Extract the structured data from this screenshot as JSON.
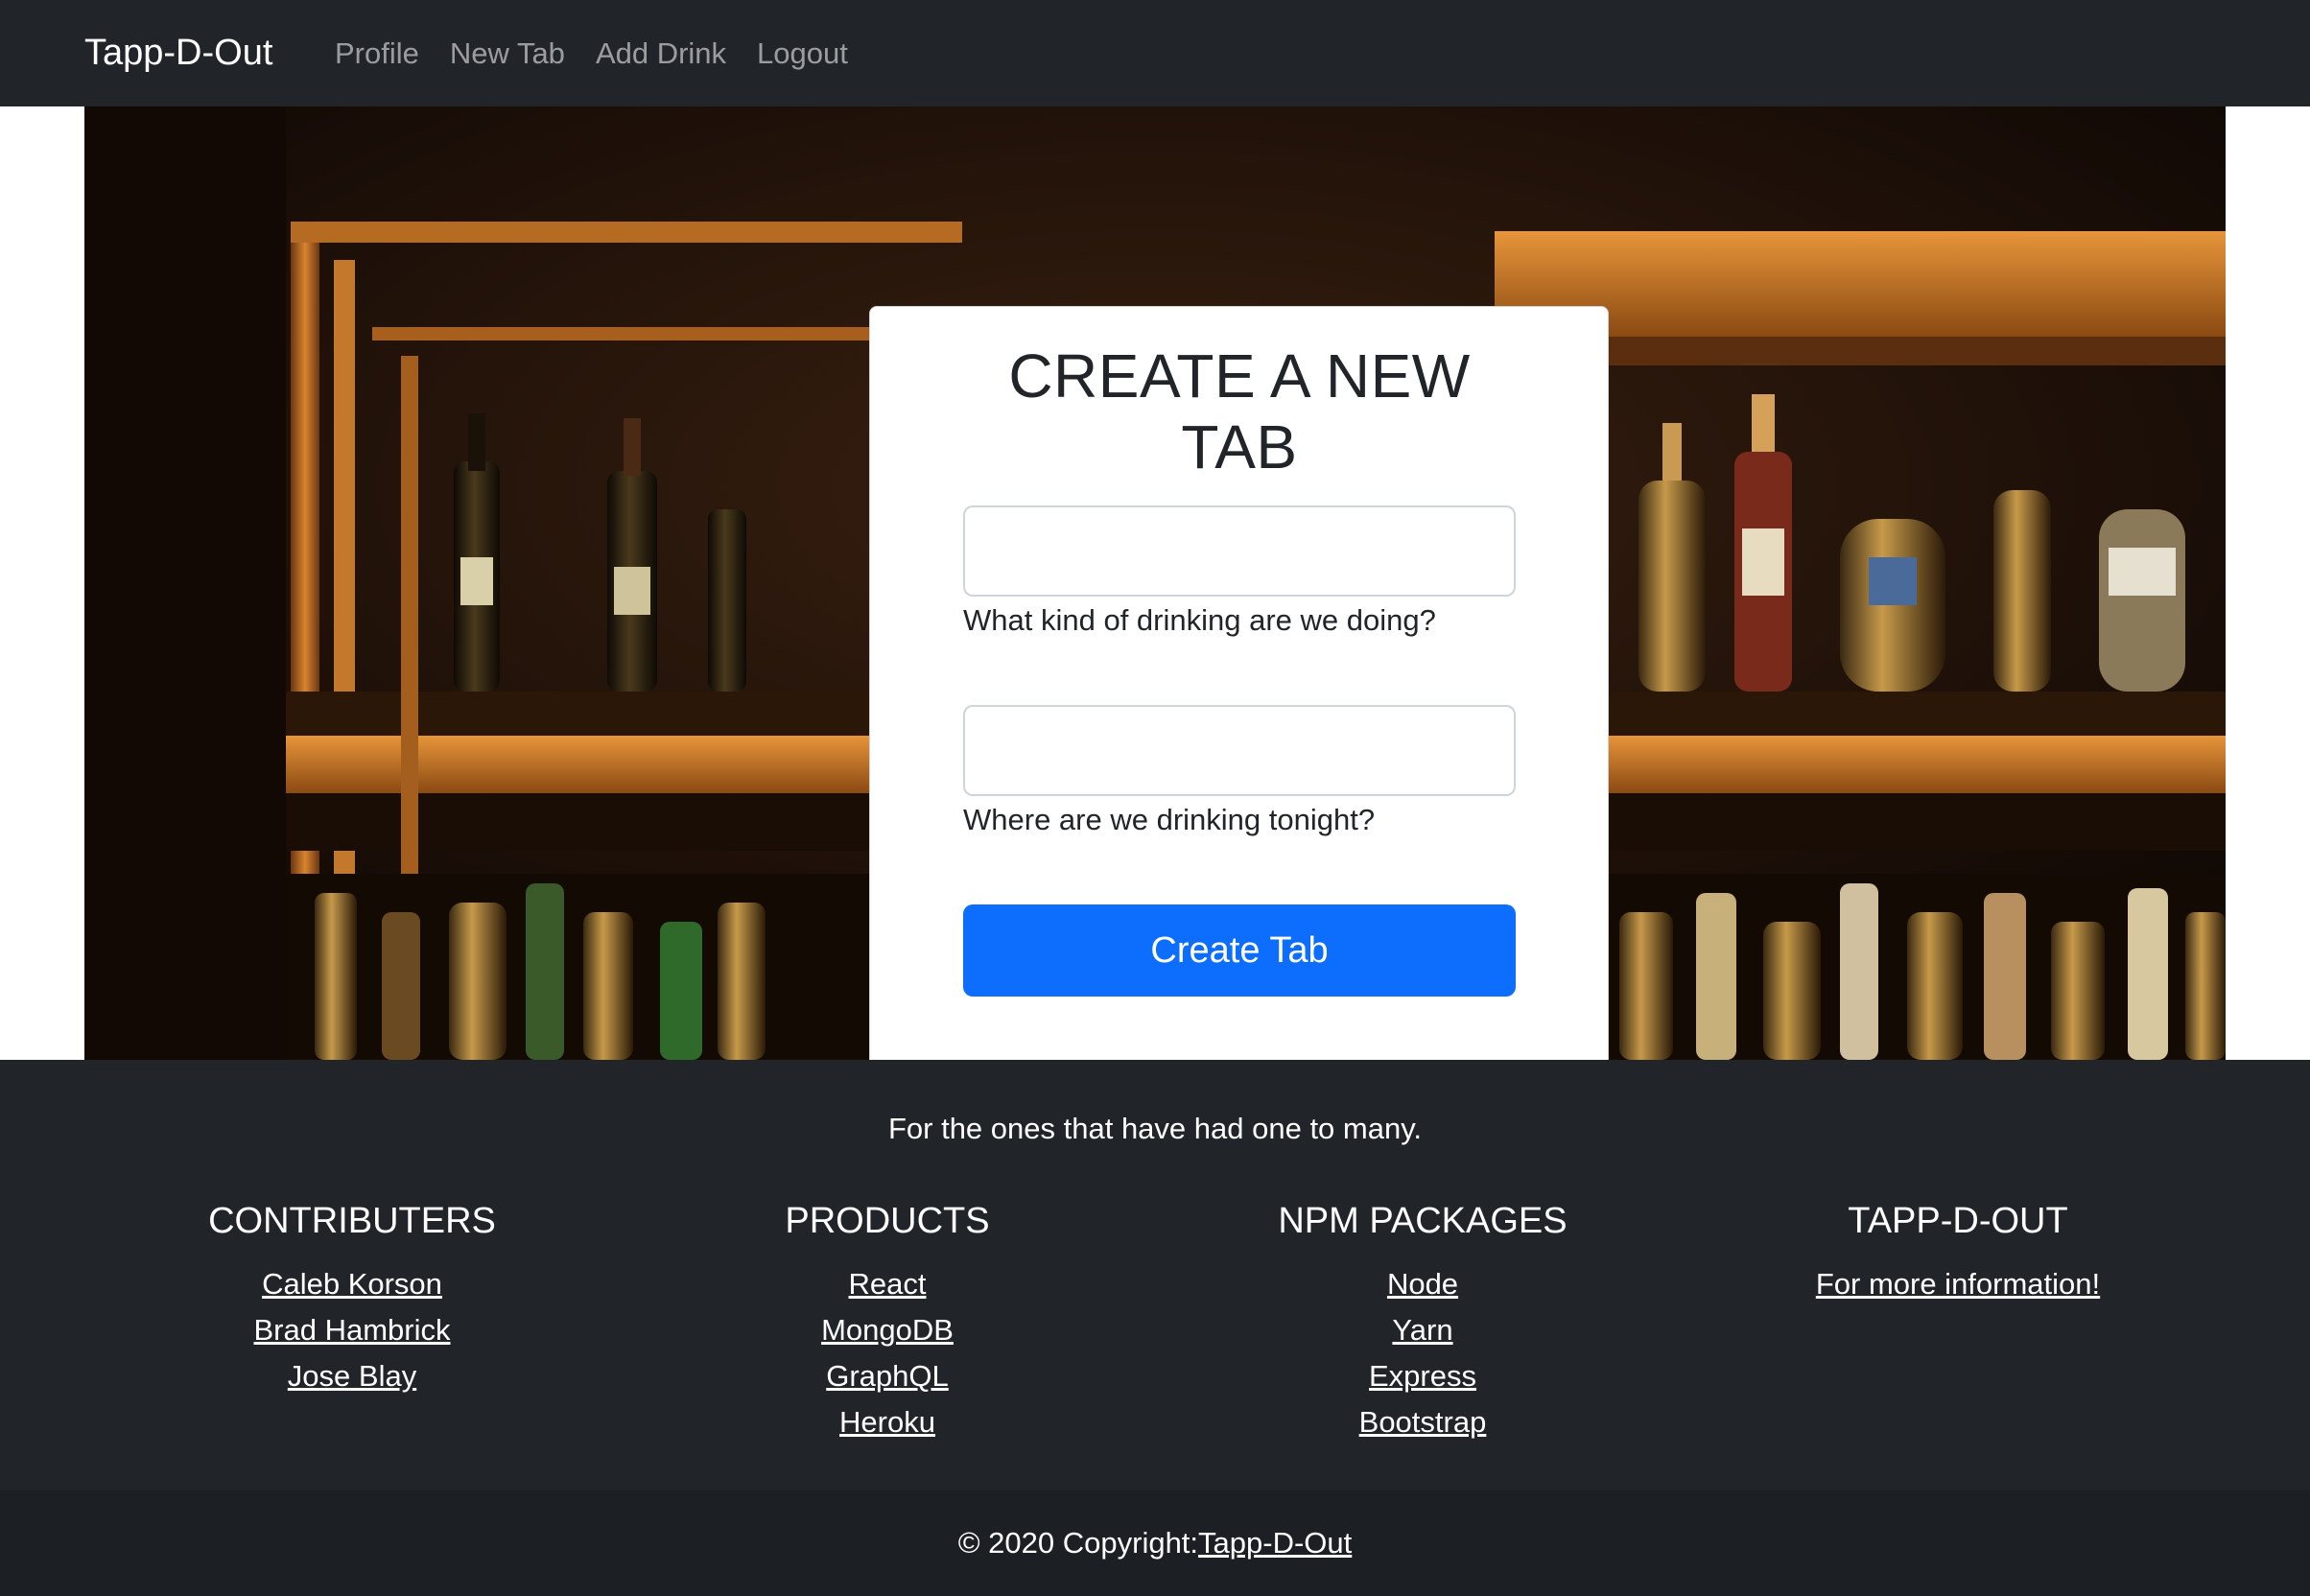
{
  "navbar": {
    "brand": "Tapp-D-Out",
    "links": [
      "Profile",
      "New Tab",
      "Add Drink",
      "Logout"
    ]
  },
  "form": {
    "title": "CREATE A NEW TAB",
    "field1_help": "What kind of drinking are we doing?",
    "field1_value": "",
    "field2_help": "Where are we drinking tonight?",
    "field2_value": "",
    "submit_label": "Create Tab",
    "submit_color": "#0d6efd"
  },
  "hero": {
    "background": "bar-shelf-bottles-image"
  },
  "footer": {
    "tagline": "For the ones that have had one to many.",
    "columns": [
      {
        "heading": "CONTRIBUTERS",
        "links": [
          "Caleb Korson",
          "Brad Hambrick",
          "Jose Blay"
        ]
      },
      {
        "heading": "PRODUCTS",
        "links": [
          "React",
          "MongoDB",
          "GraphQL",
          "Heroku"
        ]
      },
      {
        "heading": "NPM PACKAGES",
        "links": [
          "Node",
          "Yarn",
          "Express",
          "Bootstrap"
        ]
      },
      {
        "heading": "TAPP-D-OUT",
        "links": [
          "For more information!"
        ]
      }
    ],
    "copyright_text": "© 2020 Copyright:",
    "copyright_link": "Tapp-D-Out"
  },
  "colors": {
    "nav_bg": "#212529",
    "footer_bg": "#212529",
    "copyright_bg": "#1c1f23"
  }
}
